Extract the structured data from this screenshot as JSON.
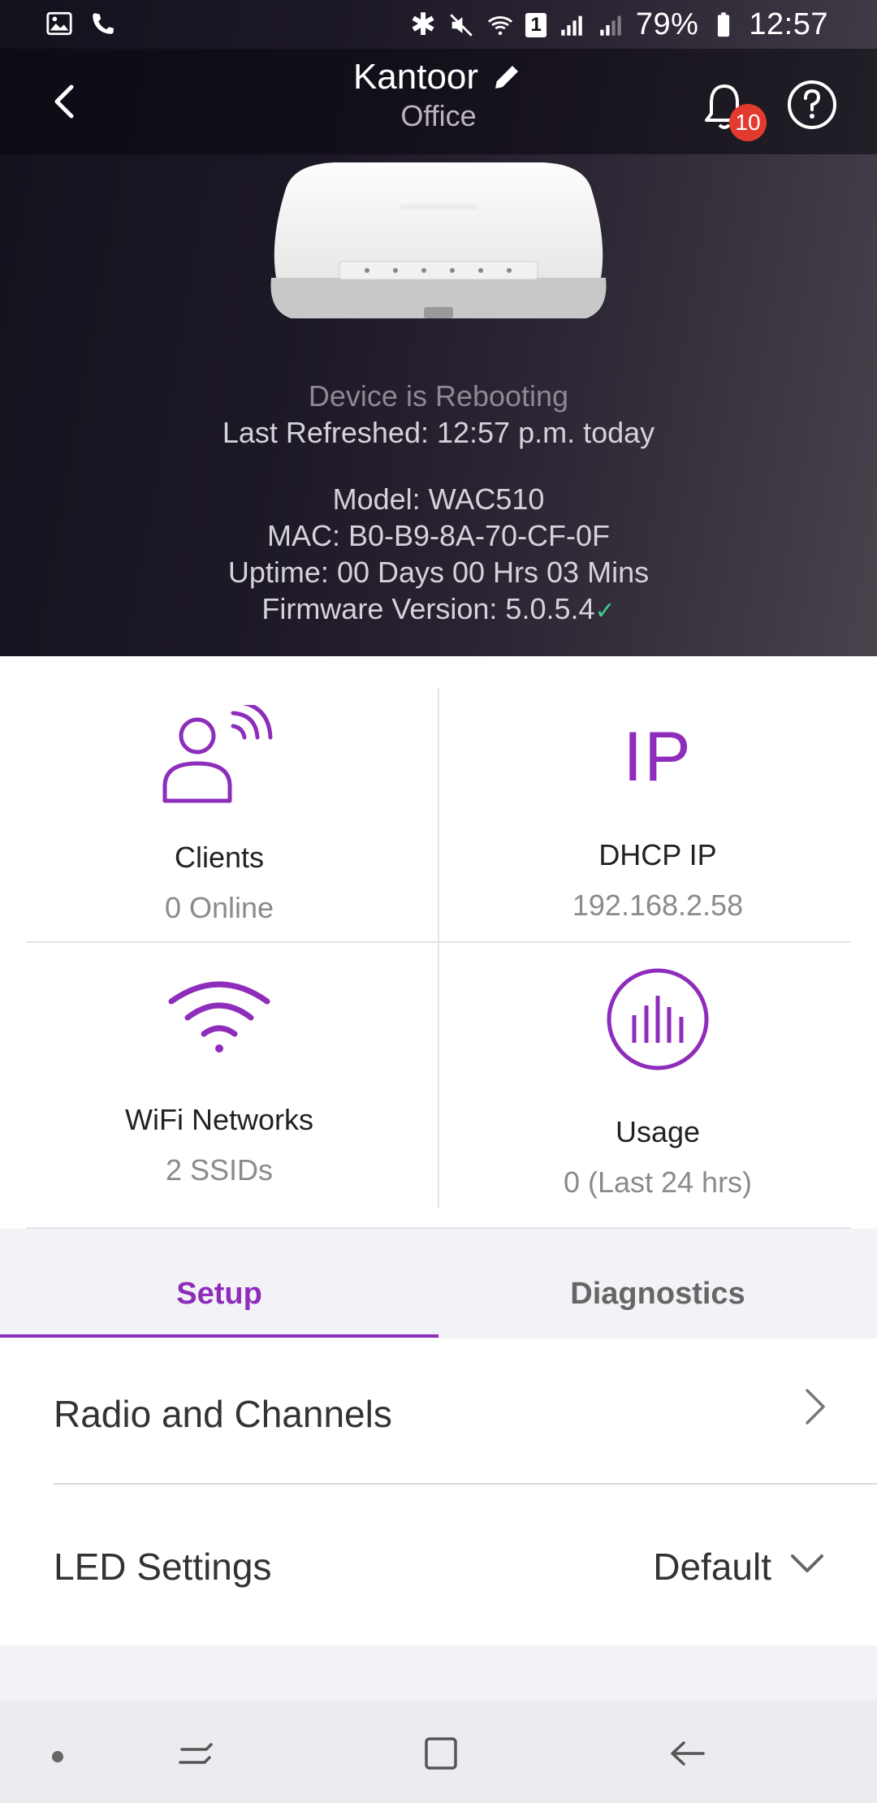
{
  "status_bar": {
    "battery": "79%",
    "time": "12:57",
    "sim_badge": "1"
  },
  "header": {
    "title": "Kantoor",
    "subtitle": "Office",
    "notification_count": "10"
  },
  "device": {
    "status": "Device is Rebooting",
    "last_refreshed": "Last Refreshed: 12:57 p.m. today",
    "model": "Model: WAC510",
    "mac": "MAC: B0-B9-8A-70-CF-0F",
    "uptime": "Uptime: 00 Days 00 Hrs 03 Mins",
    "firmware": "Firmware Version: 5.0.5.4",
    "firmware_check": "✓"
  },
  "tiles": {
    "clients": {
      "label": "Clients",
      "value": "0 Online"
    },
    "dhcp": {
      "label": "DHCP IP",
      "value": "192.168.2.58",
      "icon_text": "IP"
    },
    "wifi": {
      "label": "WiFi Networks",
      "value": "2 SSIDs"
    },
    "usage": {
      "label": "Usage",
      "value": "0 (Last 24 hrs)"
    }
  },
  "tabs": {
    "setup": "Setup",
    "diagnostics": "Diagnostics"
  },
  "settings": {
    "radio": {
      "label": "Radio and Channels"
    },
    "led": {
      "label": "LED Settings",
      "value": "Default"
    }
  },
  "colors": {
    "accent": "#8e2dbb",
    "badge": "#e23b2e",
    "check": "#3ccf8a"
  }
}
